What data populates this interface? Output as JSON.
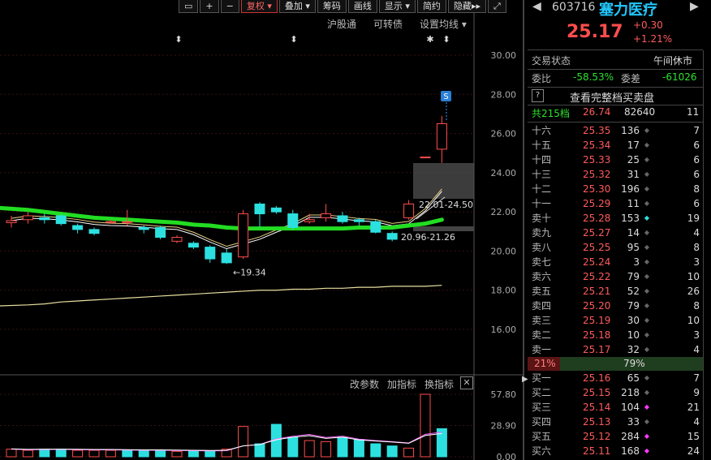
{
  "toolbar": {
    "icons": [
      "frame-icon",
      "plus-icon",
      "minus-icon"
    ],
    "buttons": [
      {
        "label": "复权",
        "active": true,
        "dropdown": true
      },
      {
        "label": "叠加",
        "active": false,
        "dropdown": true
      },
      {
        "label": "筹码",
        "active": false,
        "dropdown": false
      },
      {
        "label": "画线",
        "active": false,
        "dropdown": false
      },
      {
        "label": "显示",
        "active": false,
        "dropdown": true
      },
      {
        "label": "简约",
        "active": false,
        "dropdown": false
      },
      {
        "label": "隐藏",
        "active": false,
        "dropdown": false
      }
    ]
  },
  "chart_header": {
    "links": [
      "沪股通",
      "可转债",
      "设置均线"
    ]
  },
  "chart_data": {
    "type": "candlestick",
    "ylim": [
      15,
      31
    ],
    "y_ticks": [
      "30.00",
      "28.00",
      "26.00",
      "24.00",
      "22.00",
      "20.00",
      "18.00",
      "16.00"
    ],
    "candles": [
      {
        "o": 21.45,
        "c": 21.55,
        "h": 21.8,
        "l": 21.2
      },
      {
        "o": 21.6,
        "c": 21.8,
        "h": 22.0,
        "l": 21.4
      },
      {
        "o": 21.7,
        "c": 21.6,
        "h": 21.9,
        "l": 21.4
      },
      {
        "o": 21.8,
        "c": 21.4,
        "h": 21.9,
        "l": 21.3
      },
      {
        "o": 21.3,
        "c": 21.1,
        "h": 21.4,
        "l": 20.9
      },
      {
        "o": 21.1,
        "c": 20.9,
        "h": 21.2,
        "l": 20.8
      },
      {
        "o": 21.5,
        "c": 21.5,
        "h": 21.6,
        "l": 21.4
      },
      {
        "o": 21.5,
        "c": 21.5,
        "h": 22.1,
        "l": 21.3
      },
      {
        "o": 21.2,
        "c": 21.1,
        "h": 21.3,
        "l": 20.9
      },
      {
        "o": 21.2,
        "c": 20.7,
        "h": 21.3,
        "l": 20.6
      },
      {
        "o": 20.5,
        "c": 20.7,
        "h": 20.8,
        "l": 20.4
      },
      {
        "o": 20.4,
        "c": 20.2,
        "h": 20.5,
        "l": 20.1
      },
      {
        "o": 20.2,
        "c": 19.6,
        "h": 20.3,
        "l": 19.4
      },
      {
        "o": 19.9,
        "c": 19.4,
        "h": 20.1,
        "l": 19.34
      },
      {
        "o": 19.7,
        "c": 21.9,
        "h": 22.1,
        "l": 19.6
      },
      {
        "o": 22.4,
        "c": 21.9,
        "h": 22.5,
        "l": 21.2
      },
      {
        "o": 22.2,
        "c": 22.0,
        "h": 22.3,
        "l": 21.9
      },
      {
        "o": 21.9,
        "c": 21.2,
        "h": 22.1,
        "l": 21.1
      },
      {
        "o": 21.5,
        "c": 21.6,
        "h": 21.9,
        "l": 21.4
      },
      {
        "o": 21.7,
        "c": 21.9,
        "h": 22.4,
        "l": 21.5
      },
      {
        "o": 21.8,
        "c": 21.5,
        "h": 22.0,
        "l": 21.4
      },
      {
        "o": 21.6,
        "c": 21.5,
        "h": 21.7,
        "l": 21.3
      },
      {
        "o": 21.5,
        "c": 20.96,
        "h": 21.6,
        "l": 20.9
      },
      {
        "o": 20.9,
        "c": 20.6,
        "h": 21.0,
        "l": 20.5
      },
      {
        "o": 21.7,
        "c": 22.4,
        "h": 22.6,
        "l": 21.6
      },
      {
        "o": 24.8,
        "c": 24.8,
        "h": 24.8,
        "l": 24.8
      },
      {
        "o": 25.2,
        "c": 26.5,
        "h": 26.9,
        "l": 24.5
      }
    ],
    "ma_thick": [
      22.2,
      22.1,
      22.0,
      21.9,
      21.8,
      21.7,
      21.65,
      21.6,
      21.55,
      21.5,
      21.45,
      21.35,
      21.3,
      21.2,
      21.15,
      21.15,
      21.15,
      21.15,
      21.15,
      21.15,
      21.15,
      21.2,
      21.2,
      21.2,
      21.3,
      21.4,
      21.6
    ],
    "ma_long": [
      17.2,
      17.25,
      17.3,
      17.4,
      17.45,
      17.5,
      17.55,
      17.6,
      17.65,
      17.7,
      17.75,
      17.8,
      17.85,
      17.9,
      17.95,
      18.0,
      18.0,
      18.05,
      18.05,
      18.1,
      18.1,
      18.15,
      18.15,
      18.2,
      18.2,
      18.2,
      18.25
    ],
    "annotations": {
      "low": "19.34",
      "range1": "22.01-24.50",
      "range2": "20.96-21.26",
      "signal": "S"
    }
  },
  "volume_panel": {
    "links": [
      "改参数",
      "加指标",
      "换指标"
    ],
    "y_ticks": [
      "57.80",
      "28.90",
      "0.00"
    ],
    "values": [
      7,
      6,
      7,
      7,
      6,
      6,
      6,
      6,
      6,
      6,
      5,
      5,
      5,
      7,
      28,
      12,
      30,
      18,
      15,
      14,
      18,
      16,
      12,
      10,
      8,
      57.8,
      26
    ],
    "colors": [
      "up",
      "up",
      "dn",
      "dn",
      "up",
      "up",
      "up",
      "dn",
      "dn",
      "dn",
      "up",
      "dn",
      "dn",
      "up",
      "up",
      "dn",
      "dn",
      "dn",
      "up",
      "up",
      "dn",
      "dn",
      "dn",
      "dn",
      "up",
      "up",
      "dn"
    ]
  },
  "quote": {
    "code": "603716",
    "name": "塞力医疗",
    "price": "25.17",
    "change": "+0.30",
    "change_pct": "+1.21%",
    "status_label": "交易状态",
    "status_value": "午间休市",
    "weibi_label": "委比",
    "weibi_value": "-58.53%",
    "weicha_label": "委差",
    "weicha_value": "-61026",
    "full_book_label": "查看完整档买卖盘",
    "help": "?",
    "total_label": "共215档",
    "total_price": "26.74",
    "total_vol": "82640",
    "total_cnt": "11",
    "asks": [
      {
        "label": "十六",
        "price": "25.35",
        "vol": "136",
        "cnt": "7",
        "dot": ""
      },
      {
        "label": "十五",
        "price": "25.34",
        "vol": "17",
        "cnt": "6",
        "dot": ""
      },
      {
        "label": "十四",
        "price": "25.33",
        "vol": "25",
        "cnt": "6",
        "dot": ""
      },
      {
        "label": "十三",
        "price": "25.32",
        "vol": "31",
        "cnt": "6",
        "dot": ""
      },
      {
        "label": "十二",
        "price": "25.30",
        "vol": "196",
        "cnt": "8",
        "dot": ""
      },
      {
        "label": "十一",
        "price": "25.29",
        "vol": "11",
        "cnt": "6",
        "dot": ""
      },
      {
        "label": "卖十",
        "price": "25.28",
        "vol": "153",
        "cnt": "19",
        "dot": "cyan"
      },
      {
        "label": "卖九",
        "price": "25.27",
        "vol": "14",
        "cnt": "4",
        "dot": ""
      },
      {
        "label": "卖八",
        "price": "25.25",
        "vol": "95",
        "cnt": "8",
        "dot": ""
      },
      {
        "label": "卖七",
        "price": "25.24",
        "vol": "3",
        "cnt": "3",
        "dot": ""
      },
      {
        "label": "卖六",
        "price": "25.22",
        "vol": "79",
        "cnt": "10",
        "dot": ""
      },
      {
        "label": "卖五",
        "price": "25.21",
        "vol": "52",
        "cnt": "26",
        "dot": ""
      },
      {
        "label": "卖四",
        "price": "25.20",
        "vol": "79",
        "cnt": "8",
        "dot": ""
      },
      {
        "label": "卖三",
        "price": "25.19",
        "vol": "30",
        "cnt": "10",
        "dot": ""
      },
      {
        "label": "卖二",
        "price": "25.18",
        "vol": "10",
        "cnt": "3",
        "dot": ""
      },
      {
        "label": "卖一",
        "price": "25.17",
        "vol": "32",
        "cnt": "4",
        "dot": ""
      }
    ],
    "ratio_buy": "21%",
    "ratio_sell": "79%",
    "bids": [
      {
        "label": "买一",
        "price": "25.16",
        "vol": "65",
        "cnt": "7",
        "dot": ""
      },
      {
        "label": "买二",
        "price": "25.15",
        "vol": "218",
        "cnt": "9",
        "dot": ""
      },
      {
        "label": "买三",
        "price": "25.14",
        "vol": "104",
        "cnt": "21",
        "dot": "magenta"
      },
      {
        "label": "买四",
        "price": "25.13",
        "vol": "33",
        "cnt": "4",
        "dot": ""
      },
      {
        "label": "买五",
        "price": "25.12",
        "vol": "284",
        "cnt": "15",
        "dot": "magenta"
      },
      {
        "label": "买六",
        "price": "25.11",
        "vol": "168",
        "cnt": "24",
        "dot": "magenta"
      }
    ]
  },
  "colors": {
    "up": "#ff4d4d",
    "down": "#2de0e0",
    "ma_thick": "#22dd22",
    "bg": "#000000"
  }
}
